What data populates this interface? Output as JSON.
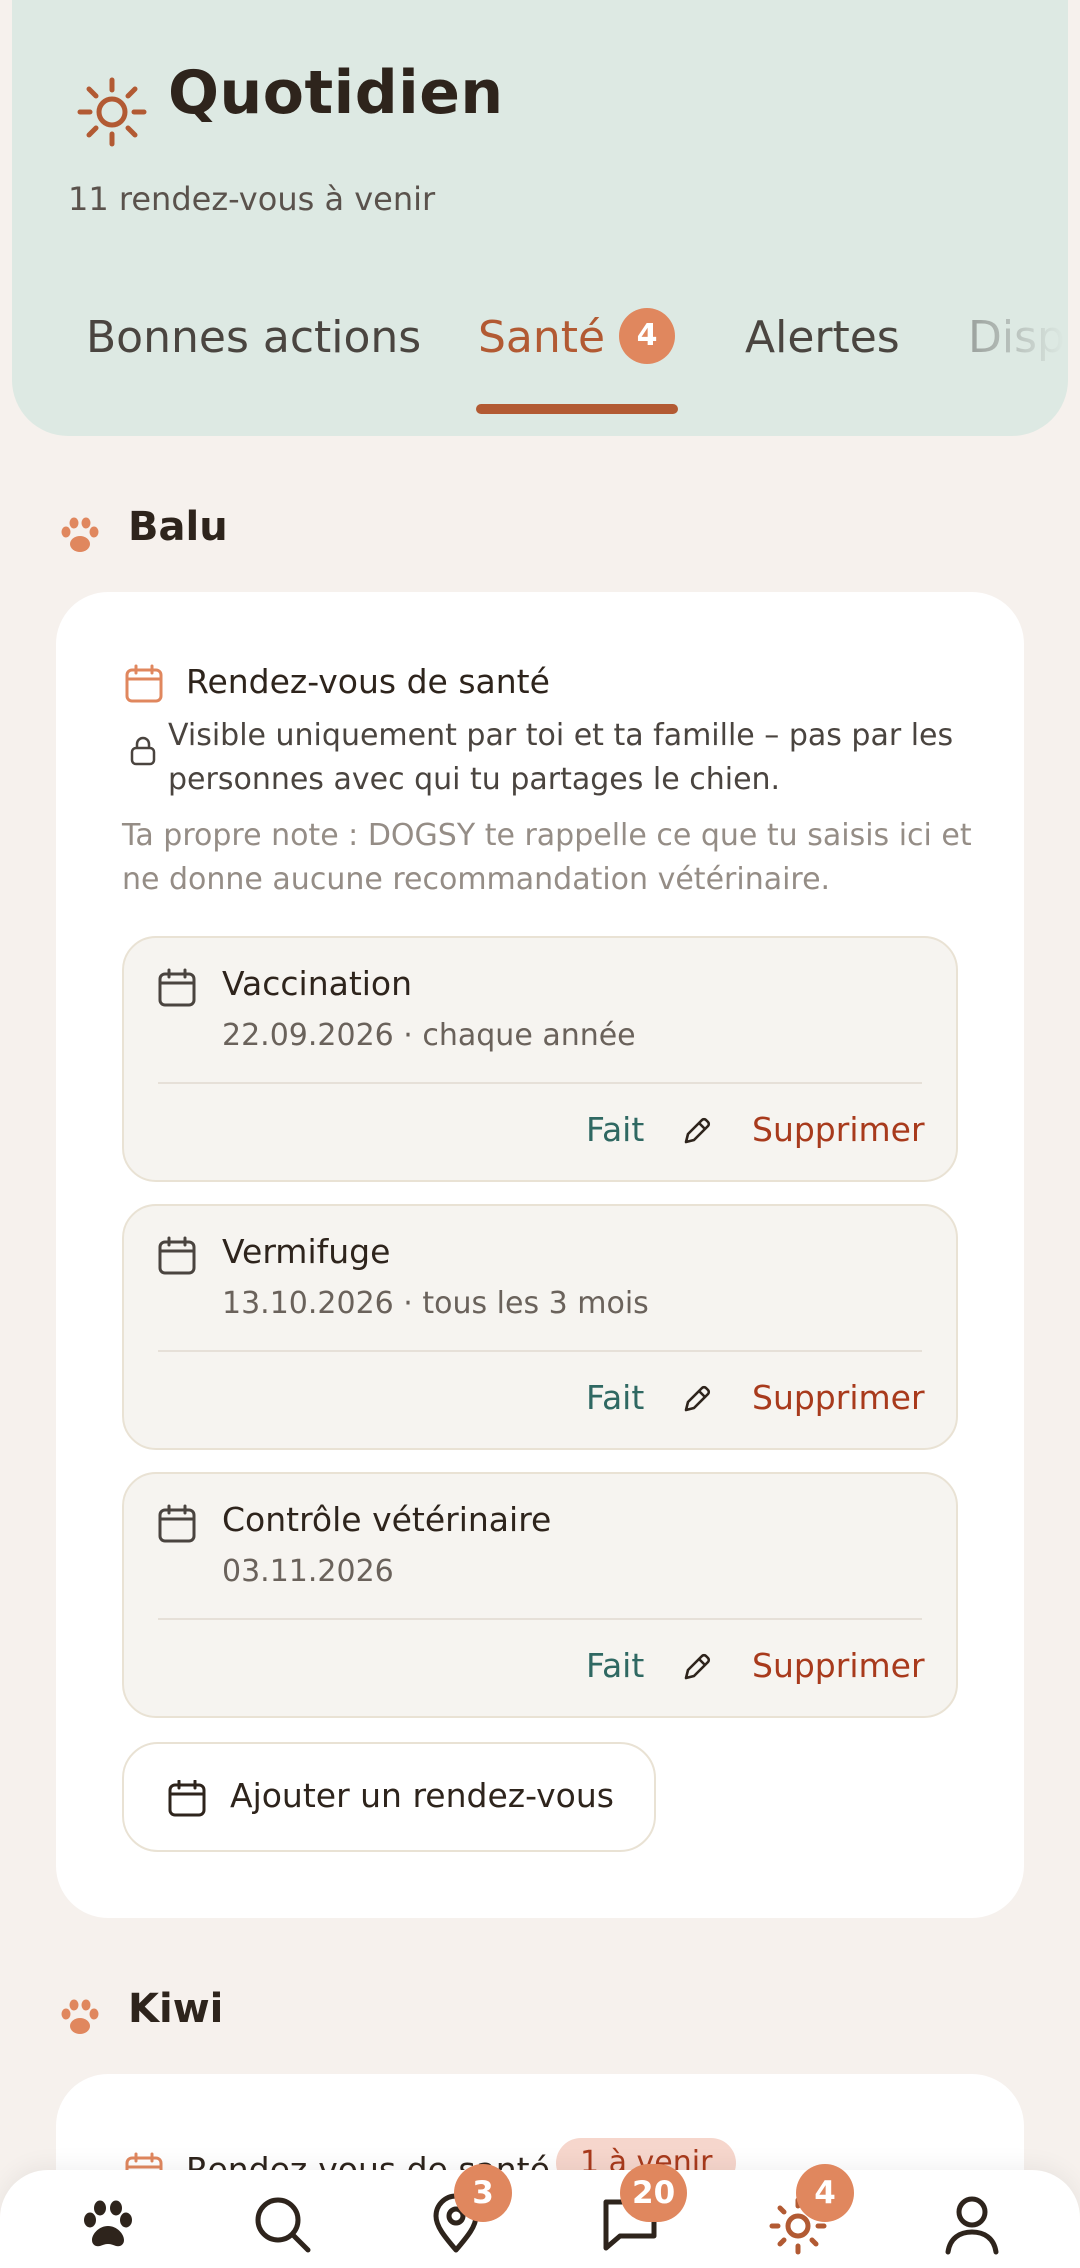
{
  "header": {
    "title": "Quotidien",
    "subtitle": "11 rendez-vous à venir",
    "icon": "sun-icon"
  },
  "tabs": [
    {
      "label": "Bonnes actions",
      "active": false
    },
    {
      "label": "Santé",
      "active": true,
      "badge": "4"
    },
    {
      "label": "Alertes",
      "active": false
    },
    {
      "label": "Disp",
      "active": false
    }
  ],
  "dogs": [
    {
      "name": "Balu",
      "card": {
        "title": "Rendez-vous de santé",
        "privacy": "Visible uniquement par toi et ta famille – pas par les personnes avec qui tu partages le chien.",
        "note": "Ta propre note : DOGSY te rappelle ce que tu saisis ici et ne donne aucune recommandation vétérinaire.",
        "appointments": [
          {
            "name": "Vaccination",
            "date": "22.09.2026 · chaque année",
            "done_label": "Fait",
            "delete_label": "Supprimer"
          },
          {
            "name": "Vermifuge",
            "date": "13.10.2026 · tous les 3 mois",
            "done_label": "Fait",
            "delete_label": "Supprimer"
          },
          {
            "name": "Contrôle vétérinaire",
            "date": "03.11.2026",
            "done_label": "Fait",
            "delete_label": "Supprimer"
          }
        ],
        "add_label": "Ajouter un rendez-vous"
      }
    },
    {
      "name": "Kiwi",
      "card": {
        "title": "Rendez-vous de santé",
        "badge": "1 à venir"
      }
    }
  ],
  "bottom_nav": [
    {
      "icon": "paw-icon",
      "badge": null
    },
    {
      "icon": "search-icon",
      "badge": null
    },
    {
      "icon": "map-pin-icon",
      "badge": "3"
    },
    {
      "icon": "chat-icon",
      "badge": "20"
    },
    {
      "icon": "sun-icon",
      "badge": "4"
    },
    {
      "icon": "user-icon",
      "badge": null
    }
  ],
  "colors": {
    "header_bg": "#dde9e3",
    "accent": "#b25a33",
    "badge": "#e0875e",
    "done": "#2f6862",
    "delete": "#a83a1c"
  }
}
